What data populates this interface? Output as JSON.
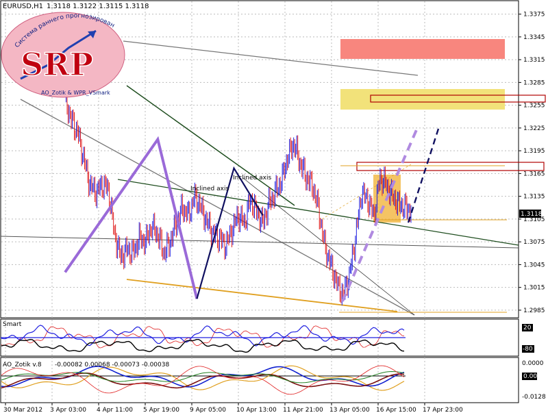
{
  "chart_data": {
    "type": "candlestick",
    "symbol": "EURUSD,H1",
    "ohlc_header": "1.3118 1.3122 1.3115 1.3118",
    "current_price": "1.3118",
    "y_ticks": [
      "1.3375",
      "1.3345",
      "1.3315",
      "1.3285",
      "1.3255",
      "1.3225",
      "1.3195",
      "1.3165",
      "1.3135",
      "1.3105",
      "1.3075",
      "1.3045",
      "1.3015",
      "1.2985"
    ],
    "ylim": [
      1.2975,
      1.339
    ],
    "x_ticks": [
      "30 Mar 2012",
      "3 Apr 03:00",
      "4 Apr 11:00",
      "5 Apr 19:00",
      "9 Apr 05:00",
      "10 Apr 13:00",
      "11 Apr 21:00",
      "13 Apr 05:00",
      "16 Apr 15:00",
      "17 Apr 23:00"
    ],
    "price_path": [
      [
        0,
        1.3265
      ],
      [
        3,
        1.3235
      ],
      [
        6,
        1.322
      ],
      [
        9,
        1.3185
      ],
      [
        12,
        1.315
      ],
      [
        15,
        1.314
      ],
      [
        18,
        1.315
      ],
      [
        21,
        1.3145
      ],
      [
        24,
        1.3085
      ],
      [
        27,
        1.3055
      ],
      [
        30,
        1.3065
      ],
      [
        33,
        1.306
      ],
      [
        36,
        1.308
      ],
      [
        39,
        1.3075
      ],
      [
        42,
        1.3095
      ],
      [
        45,
        1.3085
      ],
      [
        48,
        1.306
      ],
      [
        51,
        1.3075
      ],
      [
        54,
        1.31
      ],
      [
        57,
        1.312
      ],
      [
        60,
        1.311
      ],
      [
        63,
        1.3135
      ],
      [
        66,
        1.312
      ],
      [
        69,
        1.31
      ],
      [
        72,
        1.3085
      ],
      [
        75,
        1.308
      ],
      [
        78,
        1.307
      ],
      [
        81,
        1.309
      ],
      [
        84,
        1.311
      ],
      [
        87,
        1.31
      ],
      [
        90,
        1.313
      ],
      [
        93,
        1.3115
      ],
      [
        96,
        1.31
      ],
      [
        99,
        1.3125
      ],
      [
        102,
        1.314
      ],
      [
        105,
        1.3155
      ],
      [
        108,
        1.3185
      ],
      [
        111,
        1.3205
      ],
      [
        114,
        1.318
      ],
      [
        117,
        1.316
      ],
      [
        120,
        1.315
      ],
      [
        123,
        1.312
      ],
      [
        126,
        1.307
      ],
      [
        129,
        1.3045
      ],
      [
        132,
        1.302
      ],
      [
        135,
        1.3005
      ],
      [
        138,
        1.303
      ],
      [
        141,
        1.308
      ],
      [
        144,
        1.314
      ],
      [
        147,
        1.313
      ],
      [
        150,
        1.311
      ],
      [
        153,
        1.316
      ],
      [
        156,
        1.315
      ],
      [
        159,
        1.3135
      ],
      [
        162,
        1.3125
      ],
      [
        165,
        1.312
      ],
      [
        168,
        1.3118
      ]
    ],
    "pattern_lines": [
      {
        "name": "purple-zigzag",
        "points": [
          [
            0,
            1.3035
          ],
          [
            45,
            1.321
          ],
          [
            64,
            1.3
          ]
        ]
      },
      {
        "name": "navy-zigzag",
        "points": [
          [
            64,
            1.3
          ],
          [
            82,
            1.3172
          ],
          [
            96,
            1.311
          ]
        ]
      }
    ],
    "annotations": [
      "Inclined axis",
      "Inclined axis"
    ],
    "indicators": [
      {
        "name": "Smart",
        "levels": [
          "20",
          "-80"
        ]
      },
      {
        "name": "AO_Zotik v.8",
        "values": "-0.00082 0.00068 -0.00073 -0.00038",
        "levels": [
          "0.0000",
          "0.00",
          "-0.0128"
        ]
      }
    ]
  },
  "logo": {
    "text": "SRP",
    "top_arc": "Система раннего прогнозирования",
    "bottom": "AO_Zotik & WPR_VSmark"
  },
  "colors": {
    "bull": "#1f1fe0",
    "bear": "#e02020",
    "zigzag": "#9a6ad8",
    "navy": "#101060",
    "orange": "#e0a020",
    "red_zone": "#f8867e",
    "yellow_zone": "#f2e27a"
  }
}
